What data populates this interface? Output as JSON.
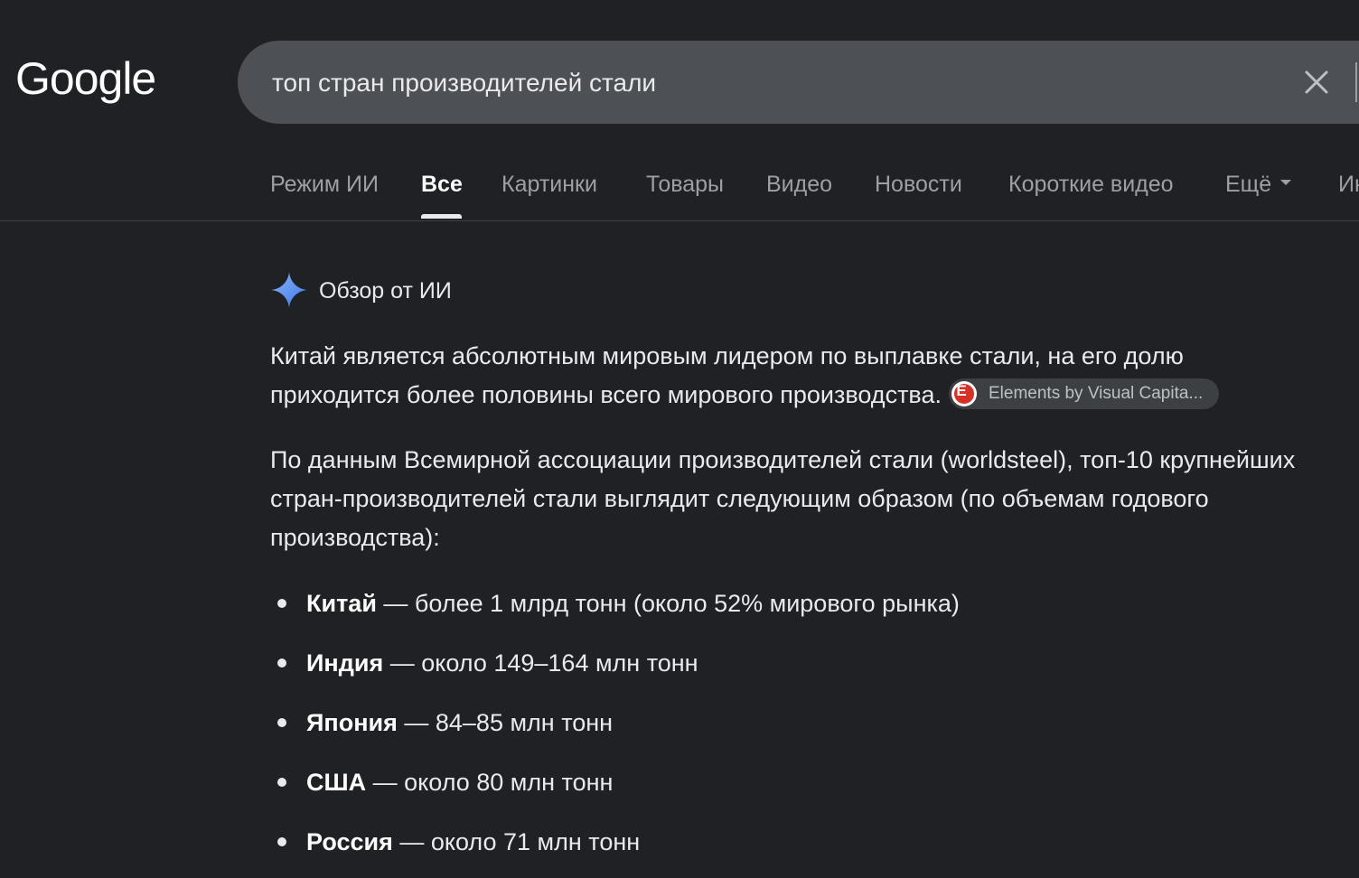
{
  "header": {
    "logo": "Google",
    "search": {
      "value": "топ стран производителей стали"
    }
  },
  "tabs": [
    {
      "label": "Режим ИИ",
      "active": false
    },
    {
      "label": "Все",
      "active": true
    },
    {
      "label": "Картинки",
      "active": false
    },
    {
      "label": "Товары",
      "active": false
    },
    {
      "label": "Видео",
      "active": false
    },
    {
      "label": "Новости",
      "active": false
    },
    {
      "label": "Короткие видео",
      "active": false
    },
    {
      "label": "Ещё",
      "active": false
    },
    {
      "label": "Ин",
      "active": false
    }
  ],
  "ai_overview": {
    "title": "Обзор от ИИ",
    "paragraph1": "Китай является абсолютным мировым лидером по выплавке стали, на его долю приходится более половины всего мирового производства.",
    "source": {
      "letter": "E",
      "label": "Elements by Visual Capita..."
    },
    "paragraph2": "По данным Всемирной ассоциации производителей стали (worldsteel), топ-10 крупнейших стран-производителей стали выглядит следующим образом (по объемам годового производства):",
    "list": [
      {
        "country": "Китай",
        "detail": " — более 1 млрд тонн (около 52% мирового рынка)"
      },
      {
        "country": "Индия",
        "detail": " — около 149–164 млн тонн"
      },
      {
        "country": "Япония",
        "detail": " — 84–85 млн тонн"
      },
      {
        "country": "США",
        "detail": " — около 80 млн тонн"
      },
      {
        "country": "Россия",
        "detail": " — около 71 млн тонн"
      }
    ]
  },
  "colors": {
    "background": "#202124",
    "searchbox": "#4d5156",
    "spark_blue": "#4f8df5"
  }
}
